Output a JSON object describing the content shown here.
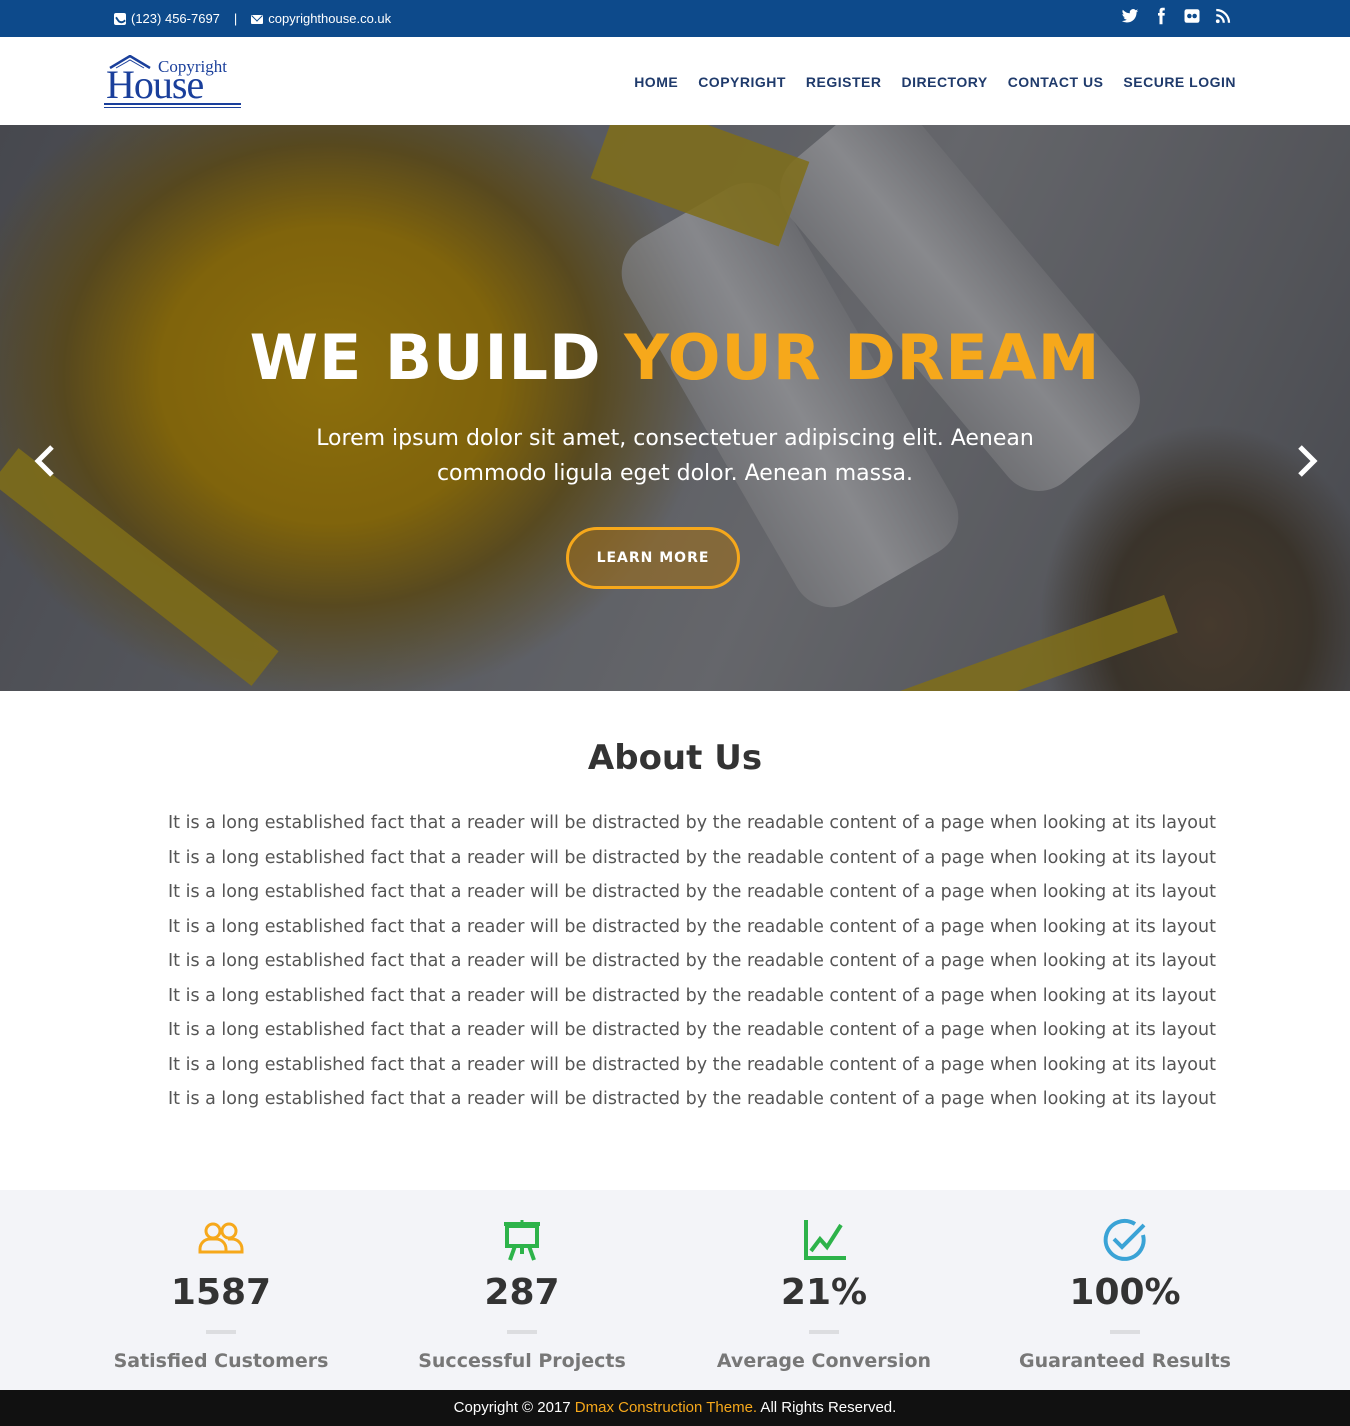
{
  "topbar": {
    "phone": "(123) 456-7697",
    "separator": "|",
    "email": "copyrighthouse.co.uk",
    "social_icons": [
      "twitter-icon",
      "facebook-icon",
      "flickr-icon",
      "rss-icon"
    ]
  },
  "logo": {
    "line1": "Copyright",
    "line2": "House"
  },
  "nav": {
    "items": [
      "HOME",
      "COPYRIGHT",
      "REGISTER",
      "DIRECTORY",
      "CONTACT US",
      "SECURE LOGIN"
    ]
  },
  "hero": {
    "title_white": "WE BUILD ",
    "title_highlight": "YOUR DREAM",
    "subtitle": "Lorem ipsum dolor sit amet, consectetuer adipiscing elit. Aenean commodo ligula eget dolor. Aenean massa.",
    "button": "LEARN MORE"
  },
  "about": {
    "title": "About Us",
    "lines": [
      "It is a long established fact that a reader will be distracted by the readable content of a page when looking at its layout",
      "It is a long established fact that a reader will be distracted by the readable content of a page when looking at its layout",
      "It is a long established fact that a reader will be distracted by the readable content of a page when looking at its layout",
      "It is a long established fact that a reader will be distracted by the readable content of a page when looking at its layout",
      "It is a long established fact that a reader will be distracted by the readable content of a page when looking at its layout",
      "It is a long established fact that a reader will be distracted by the readable content of a page when looking at its layout",
      "It is a long established fact that a reader will be distracted by the readable content of a page when looking at its layout",
      "It is a long established fact that a reader will be distracted by the readable content of a page when looking at its layout",
      "It is a long established fact that a reader will be distracted by the readable content of a page when looking at its layout"
    ]
  },
  "stats": [
    {
      "icon": "users-icon",
      "value": "1587",
      "label": "Satisfied Customers",
      "color": "#f6a81b"
    },
    {
      "icon": "presentation-icon",
      "value": "287",
      "label": "Successful Projects",
      "color": "#2db34a"
    },
    {
      "icon": "chart-line-icon",
      "value": "21%",
      "label": "Average Conversion",
      "color": "#2db34a"
    },
    {
      "icon": "check-circle-icon",
      "value": "100%",
      "label": "Guaranteed Results",
      "color": "#3aa3d6"
    }
  ],
  "footer": {
    "prefix": "Copyright © 2017 ",
    "link": "Dmax Construction Theme.",
    "suffix": " All Rights Reserved."
  },
  "colors": {
    "topbar": "#0d4a8b",
    "accent": "#f6a81b",
    "nav_text": "#1f3a6b",
    "footer_bg": "#111111"
  }
}
